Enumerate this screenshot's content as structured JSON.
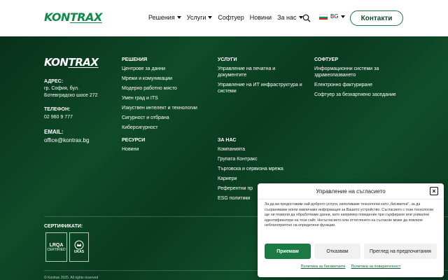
{
  "header": {
    "logo_a": "KON",
    "logo_b": "TRAX",
    "nav": [
      {
        "label": "Решения",
        "dropdown": true
      },
      {
        "label": "Услуги",
        "dropdown": true
      },
      {
        "label": "Софтуер",
        "dropdown": false
      },
      {
        "label": "Новини",
        "dropdown": false
      },
      {
        "label": "За нас",
        "dropdown": true
      }
    ],
    "lang": "BG",
    "contact_label": "Контакти"
  },
  "footer": {
    "logo_a": "KON",
    "logo_b": "TRAX",
    "address_label": "АДРЕС:",
    "address_line1": "гр. София, бул.",
    "address_line2": "Ботевградско шосе 272",
    "phone_label": "ТЕЛЕФОН:",
    "phone": "02 960 9 777",
    "email_label": "EMAIL:",
    "email": "office@kontrax.bg",
    "solutions": {
      "title": "РЕШЕНИЯ",
      "items": [
        "Центрове за данни",
        "Мрежи и комуникации",
        "Модерно работно място",
        "Умен град и ITS",
        "Изкуствен интелект и технологии",
        "Сигурност и отбрана",
        "Киберсигурност"
      ]
    },
    "resources": {
      "title": "РЕСУРСИ",
      "items": [
        "Новини"
      ]
    },
    "services": {
      "title": "УСЛУГИ",
      "items": [
        "Управление на печатна и документите",
        "Управление на ИТ инфраструктура и системи"
      ]
    },
    "about": {
      "title": "ЗА НАС",
      "items": [
        "Компанията",
        "Групата Контракс",
        "Търговска и сервизна мрежа",
        "Кариери",
        "Референтни пр",
        "ESG политики"
      ]
    },
    "software": {
      "title": "СОФТУЕР",
      "items": [
        "Информационни системи за здравеопазването",
        "Електронно фактуриране",
        "Софтуер за безхартиено заседание"
      ]
    },
    "certs_label": "СЕРТИФИКАТИ:",
    "cert1_a": "LRQA",
    "cert1_b": "CERTIFIED",
    "cert2": "UKAS",
    "copyright": "© Kontrax 2025. All rights reserved"
  },
  "consent": {
    "title": "Управление на съгласието",
    "body": "За да ви предоставим най-доброто услуги, използваме технологии като „бисквитки\", за да съхраняваме и/или извличаме информация за Вашето устройство. Съгласието с тези технологии ще ни позволи да обработваме данни, като например поведение при сърфиране или уникални идентификатори на този сайт. Несъгласието или оттеглянето на съгласие може да повлияе неблагоприятно на определени функции.",
    "accept_label": "Приемам",
    "deny_label": "Отказвам",
    "prefs_label": "Преглед на предпочитания",
    "link_cookies": "Политика за бисквитките",
    "link_privacy": "Политика за поверителност"
  },
  "colors": {
    "brand_green": "#1b7a44",
    "footer_bg": "#0d3b22"
  }
}
